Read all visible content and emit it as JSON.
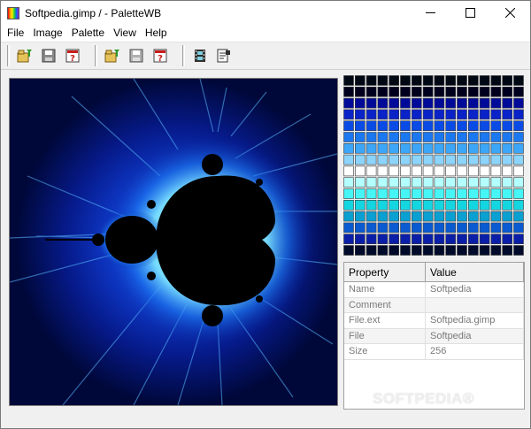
{
  "window": {
    "title": "Softpedia.gimp /  - PaletteWB"
  },
  "menu": {
    "items": [
      "File",
      "Image",
      "Palette",
      "View",
      "Help"
    ]
  },
  "toolbar": {
    "groups": [
      [
        "open-icon",
        "save-icon",
        "about-icon"
      ],
      [
        "open-icon",
        "save-icon",
        "about-icon"
      ],
      [
        "film-icon",
        "properties-icon"
      ]
    ]
  },
  "palette": {
    "rows": 16,
    "cols": 16,
    "row_colors": [
      "#000814",
      "#00001e",
      "#000a99",
      "#0a23c8",
      "#0a4be6",
      "#1c78f0",
      "#3ca6f8",
      "#8cd4fc",
      "#ffffff",
      "#b4ffff",
      "#46f6f6",
      "#14d6e0",
      "#0aa0d2",
      "#0a5ad2",
      "#0a1ea8",
      "#000a2a"
    ]
  },
  "properties": {
    "columns": [
      "Property",
      "Value"
    ],
    "rows": [
      {
        "property": "Name",
        "value": "Softpedia"
      },
      {
        "property": "Comment",
        "value": ""
      },
      {
        "property": "File.ext",
        "value": "Softpedia.gimp"
      },
      {
        "property": "File",
        "value": "Softpedia"
      },
      {
        "property": "Size",
        "value": "256"
      }
    ]
  },
  "watermark": "SOFTPEDIA®"
}
